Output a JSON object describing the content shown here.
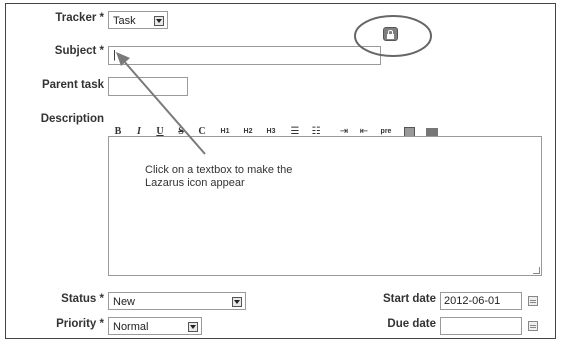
{
  "form": {
    "tracker": {
      "label": "Tracker *",
      "value": "Task"
    },
    "subject": {
      "label": "Subject *",
      "value": "|"
    },
    "parent_task": {
      "label": "Parent task",
      "value": ""
    },
    "description": {
      "label": "Description"
    },
    "toolbar": [
      "B",
      "I",
      "U",
      "S",
      "C",
      "H1",
      "H2",
      "H3",
      "ul",
      "ol",
      "indent",
      "outdent",
      "pre",
      "img",
      "link"
    ],
    "annotation": "Click on a textbox to make the\nLazarus icon appear",
    "status": {
      "label": "Status *",
      "value": "New"
    },
    "priority": {
      "label": "Priority *",
      "value": "Normal"
    },
    "start_date": {
      "label": "Start date",
      "value": "2012-06-01"
    },
    "due_date": {
      "label": "Due date",
      "value": ""
    }
  },
  "icons": {
    "lazarus": "lazarus-icon",
    "calendar": "calendar-icon"
  },
  "colors": {
    "highlight_circle": "#666666",
    "arrow": "#7a7a7a"
  }
}
